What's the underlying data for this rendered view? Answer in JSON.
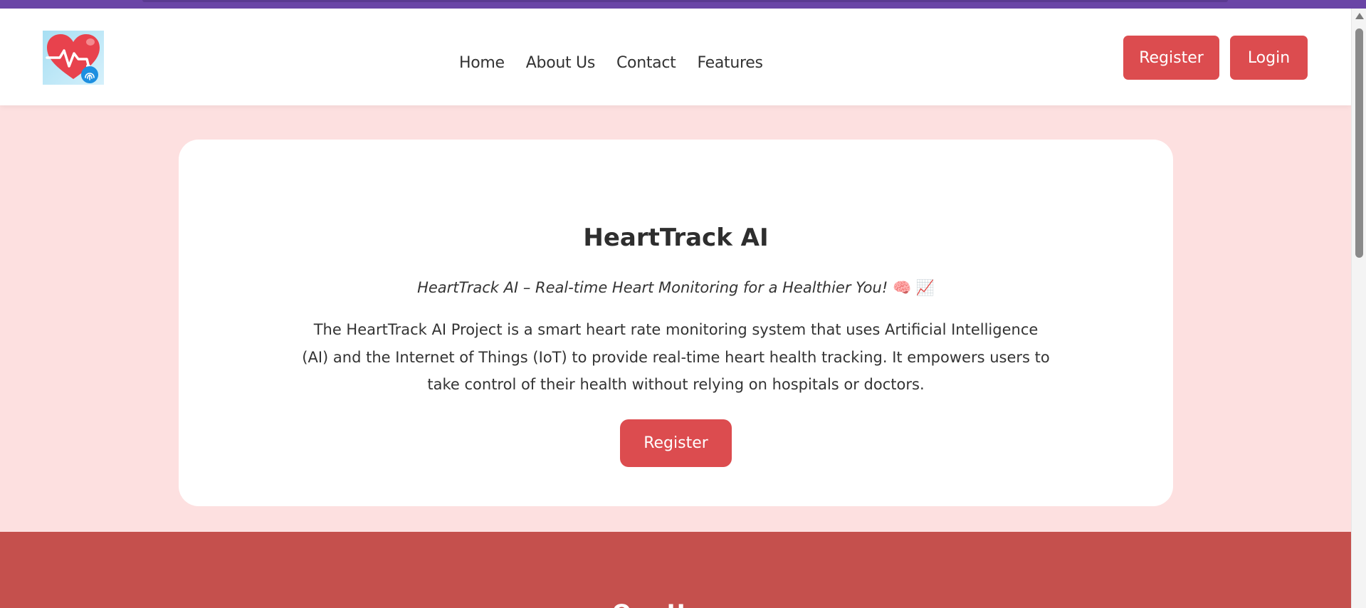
{
  "brand": {
    "logo_icon": "heart-pulse-fingerprint-icon",
    "colors": {
      "accent": "#dc4c4f",
      "page_background": "#fde0e0",
      "section_background": "#c5504d"
    }
  },
  "nav": {
    "links": [
      "Home",
      "About Us",
      "Contact",
      "Features"
    ],
    "register_label": "Register",
    "login_label": "Login"
  },
  "hero": {
    "title": "HeartTrack AI",
    "tagline": "HeartTrack AI – Real-time Heart Monitoring for a Healthier You!",
    "tagline_emojis": "🧠 📈",
    "description": "The HeartTrack AI Project is a smart heart rate monitoring system that uses Artificial Intelligence (AI) and the Internet of Things (IoT) to provide real-time heart health tracking. It empowers users to take control of their health without relying on hospitals or doctors.",
    "cta_label": "Register"
  },
  "users_section": {
    "title": "Our Users"
  }
}
